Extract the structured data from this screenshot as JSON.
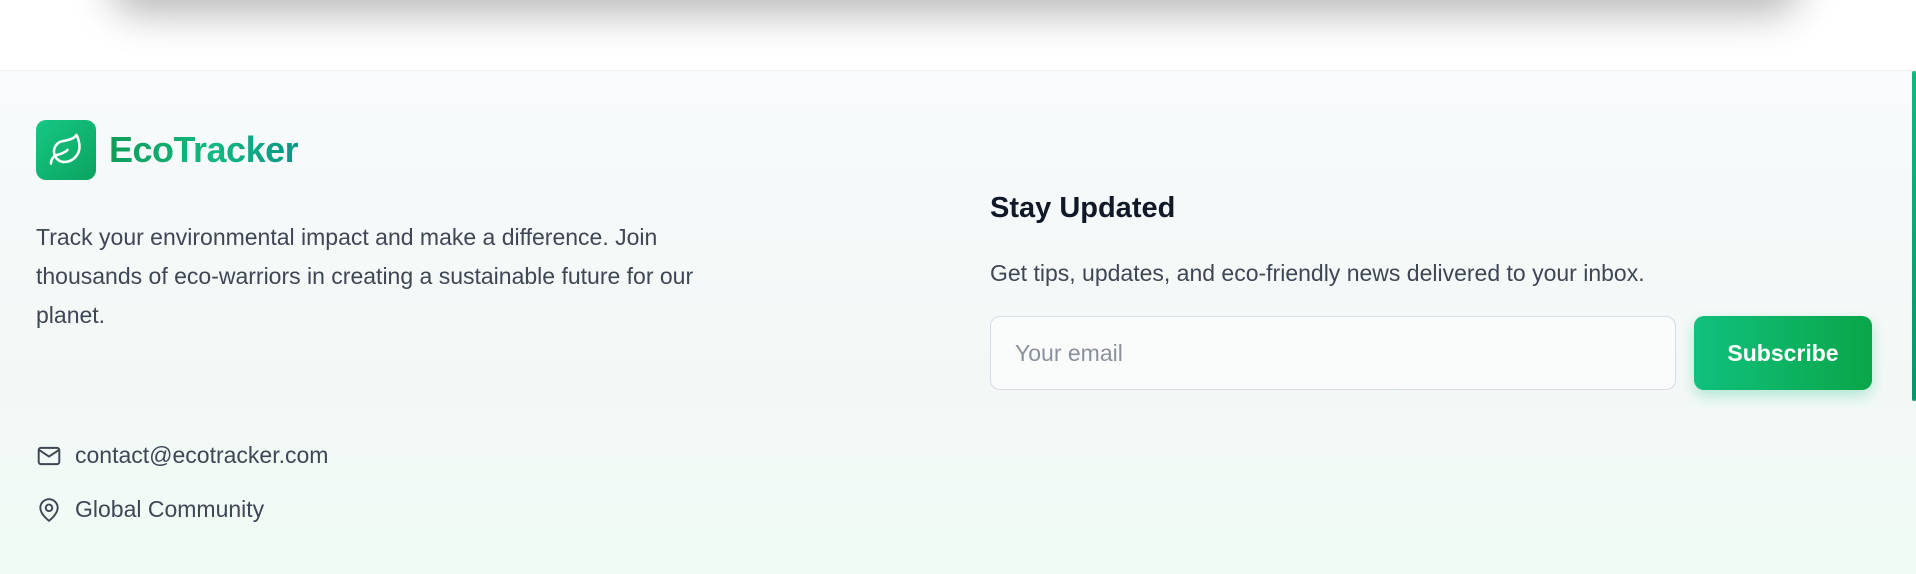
{
  "brand": {
    "name": "EcoTracker",
    "logo_icon": "leaf-icon",
    "description": "Track your environmental impact and make a difference. Join thousands of eco-warriors in creating a sustainable future for our planet."
  },
  "contact": {
    "email": "contact@ecotracker.com",
    "email_icon": "mail-icon",
    "location": "Global Community",
    "location_icon": "map-pin-icon"
  },
  "newsletter": {
    "title": "Stay Updated",
    "description": "Get tips, updates, and eco-friendly news delivered to your inbox.",
    "email_placeholder": "Your email",
    "email_value": "",
    "subscribe_label": "Subscribe"
  },
  "colors": {
    "brand_green": "#10b981",
    "button_start": "#10c07e",
    "button_end": "#0aa648",
    "heading": "#111827",
    "body_text": "#3f4654"
  }
}
